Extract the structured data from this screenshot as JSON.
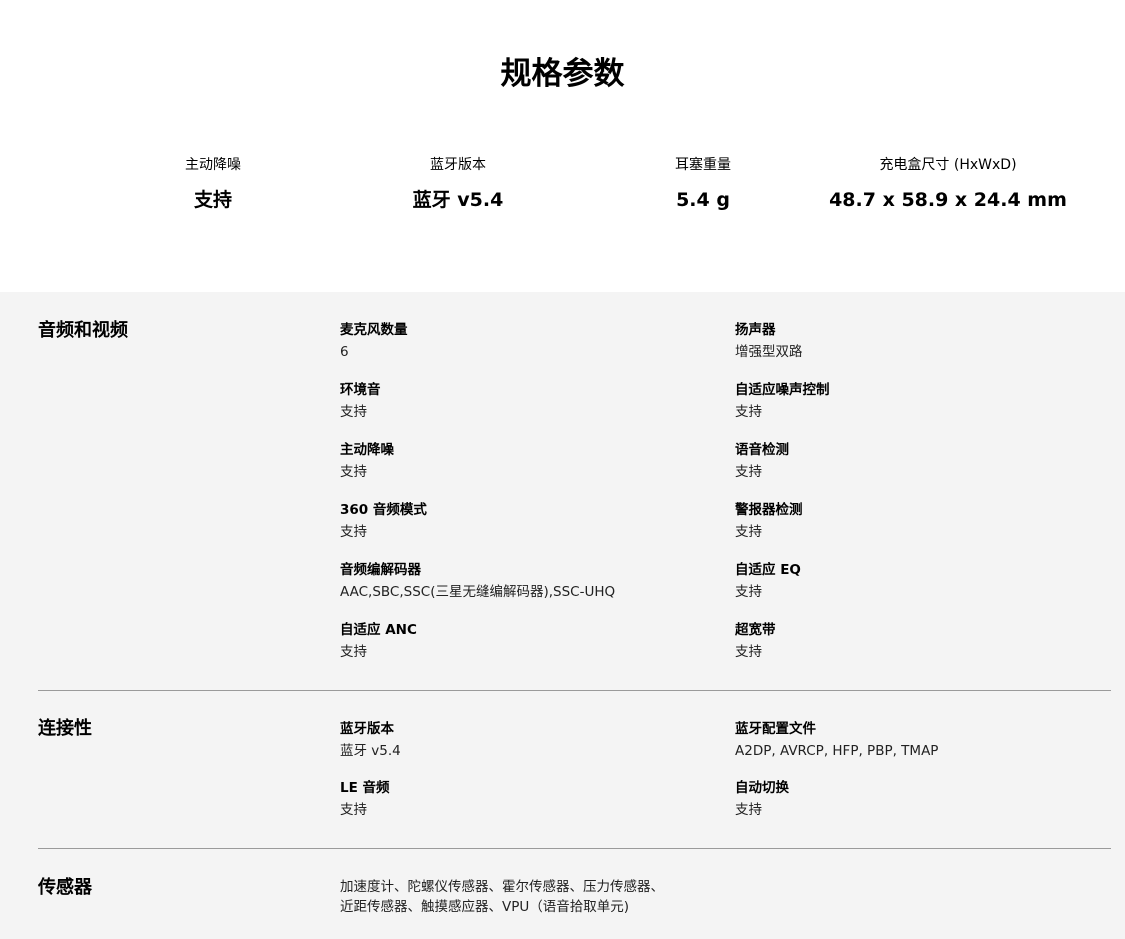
{
  "page_title": "规格参数",
  "highlights": [
    {
      "label": "主动降噪",
      "value": "支持"
    },
    {
      "label": "蓝牙版本",
      "value": "蓝牙 v5.4"
    },
    {
      "label": "耳塞重量",
      "value": "5.4 g"
    },
    {
      "label": "充电盒尺寸 (HxWxD)",
      "value": "48.7 x 58.9 x 24.4 mm"
    }
  ],
  "sections": {
    "audio_video": {
      "title": "音频和视频",
      "items": [
        {
          "name": "麦克风数量",
          "value": "6"
        },
        {
          "name": "扬声器",
          "value": "增强型双路"
        },
        {
          "name": "环境音",
          "value": "支持"
        },
        {
          "name": "自适应噪声控制",
          "value": "支持"
        },
        {
          "name": "主动降噪",
          "value": "支持"
        },
        {
          "name": "语音检测",
          "value": "支持"
        },
        {
          "name": "360 音频模式",
          "value": "支持"
        },
        {
          "name": "警报器检测",
          "value": "支持"
        },
        {
          "name": "音频编解码器",
          "value": "AAC,SBC,SSC(三星无缝编解码器),SSC-UHQ"
        },
        {
          "name": "自适应 EQ",
          "value": "支持"
        },
        {
          "name": "自适应 ANC",
          "value": "支持"
        },
        {
          "name": "超宽带",
          "value": "支持"
        }
      ]
    },
    "connectivity": {
      "title": "连接性",
      "items": [
        {
          "name": "蓝牙版本",
          "value": "蓝牙 v5.4"
        },
        {
          "name": "蓝牙配置文件",
          "value": "A2DP, AVRCP, HFP, PBP, TMAP"
        },
        {
          "name": "LE 音频",
          "value": "支持"
        },
        {
          "name": "自动切换",
          "value": "支持"
        }
      ]
    },
    "sensors": {
      "title": "传感器",
      "line1": "加速度计、陀螺仪传感器、霍尔传感器、压力传感器、",
      "line2": "近距传感器、触摸感应器、VPU（语音拾取单元)"
    }
  }
}
